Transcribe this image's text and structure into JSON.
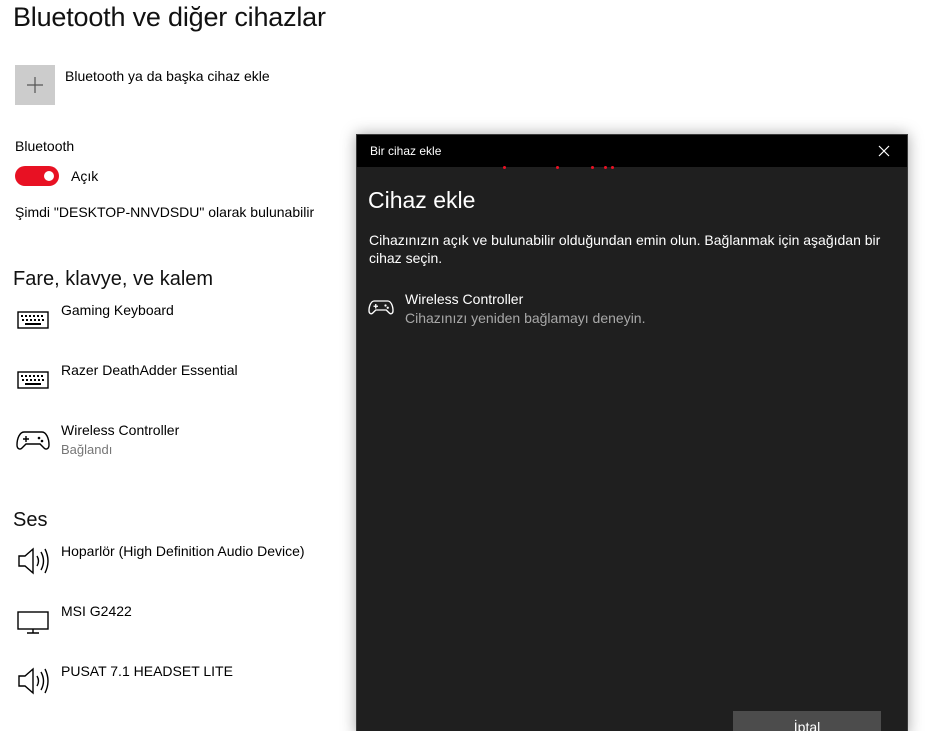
{
  "page": {
    "title": "Bluetooth ve diğer cihazlar",
    "add_device_label": "Bluetooth ya da başka cihaz ekle",
    "bluetooth_label": "Bluetooth",
    "bluetooth_state": "Açık",
    "discoverable_text": "Şimdi \"DESKTOP-NNVDSDU\" olarak bulunabilir"
  },
  "sections": {
    "input_heading": "Fare, klavye, ve kalem",
    "input_devices": [
      {
        "name": "Gaming Keyboard",
        "status": "",
        "icon": "keyboard-icon"
      },
      {
        "name": "Razer DeathAdder Essential",
        "status": "",
        "icon": "keyboard-icon"
      },
      {
        "name": "Wireless Controller",
        "status": "Bağlandı",
        "icon": "gamepad-icon"
      }
    ],
    "audio_heading": "Ses",
    "audio_devices": [
      {
        "name": "Hoparlör (High Definition Audio Device)",
        "icon": "speaker-icon"
      },
      {
        "name": "MSI G2422",
        "icon": "monitor-icon"
      },
      {
        "name": "PUSAT 7.1 HEADSET LITE",
        "icon": "speaker-icon"
      }
    ]
  },
  "dialog": {
    "window_title": "Bir cihaz ekle",
    "heading": "Cihaz ekle",
    "description": "Cihazınızın açık ve bulunabilir olduğundan emin olun. Bağlanmak için aşağıdan bir cihaz seçin.",
    "device": {
      "name": "Wireless Controller",
      "status": "Cihazınızı yeniden bağlamayı deneyin.",
      "icon": "gamepad-icon"
    },
    "cancel_label": "İptal"
  },
  "colors": {
    "accent": "#e81123",
    "dialog_bg": "#1f1f1f",
    "titlebar_bg": "#000000",
    "button_bg": "#4c4c4c",
    "secondary_text": "#767676"
  }
}
